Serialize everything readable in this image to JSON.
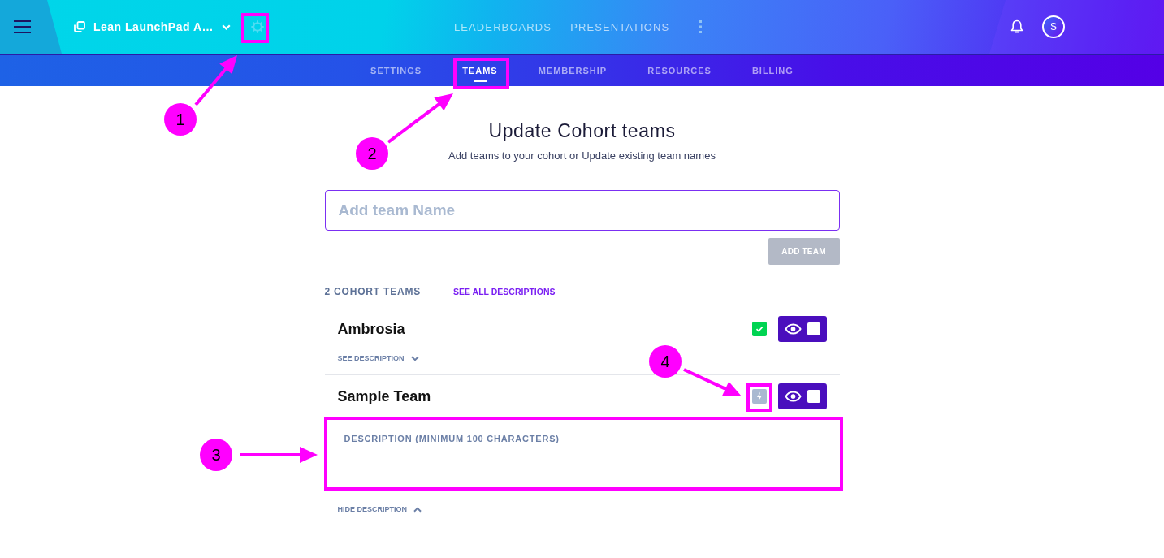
{
  "header": {
    "project": "Lean LaunchPad A…",
    "nav": [
      "LEADERBOARDS",
      "PRESENTATIONS"
    ],
    "avatar": "S"
  },
  "subnav": [
    {
      "label": "SETTINGS",
      "selected": false
    },
    {
      "label": "TEAMS",
      "selected": true
    },
    {
      "label": "MEMBERSHIP",
      "selected": false
    },
    {
      "label": "RESOURCES",
      "selected": false
    },
    {
      "label": "BILLING",
      "selected": false
    }
  ],
  "page": {
    "title": "Update Cohort teams",
    "subtitle": "Add teams to your cohort or Update existing team names"
  },
  "add_team": {
    "placeholder": "Add team Name",
    "button": {
      "label": "ADD TEAM",
      "disabled": true
    }
  },
  "teams_header": {
    "count": "2 COHORT TEAMS",
    "link": "SEE ALL DESCRIPTIONS"
  },
  "teams": [
    {
      "name": "Ambrosia",
      "complete": true,
      "checked": false,
      "expanded": false,
      "toggle": "SEE DESCRIPTION"
    },
    {
      "name": "Sample Team",
      "complete": false,
      "checked": false,
      "expanded": true,
      "description": {
        "placeholder": "DESCRIPTION (MINIMUM 100 CHARACTERS)"
      },
      "toggle": "HIDE DESCRIPTION"
    }
  ],
  "annotations": [
    {
      "number": "1"
    },
    {
      "number": "2"
    },
    {
      "number": "3"
    },
    {
      "number": "4"
    }
  ]
}
